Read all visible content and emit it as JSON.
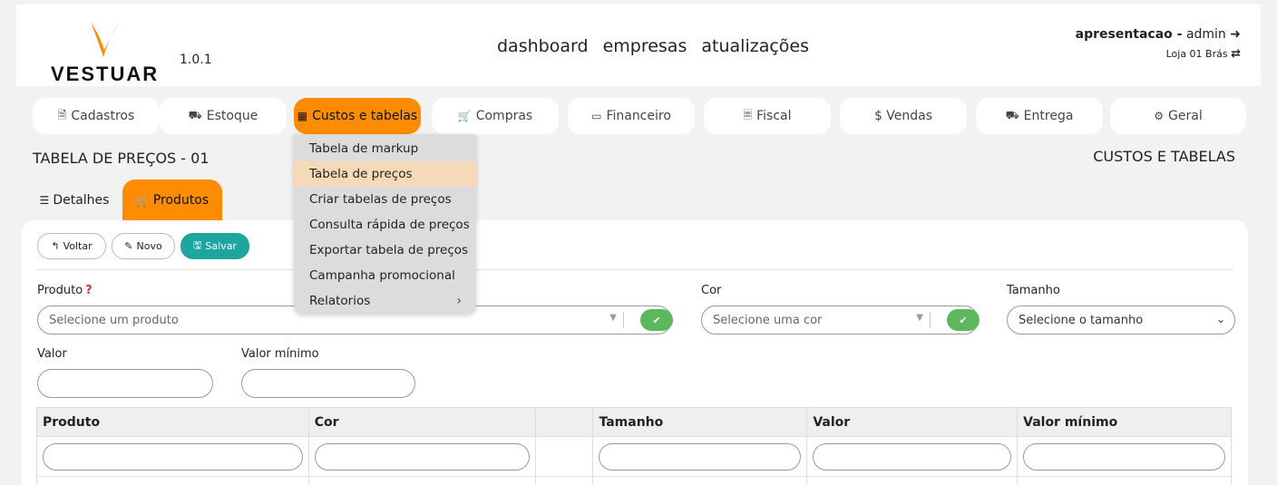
{
  "brand": {
    "name": "VESTUAR",
    "version": "1.0.1",
    "accent": "#ff8c00"
  },
  "topnav": {
    "items": [
      "dashboard",
      "empresas",
      "atualizações"
    ]
  },
  "user": {
    "company": "apresentacao -",
    "role": "admin",
    "store": "Loja 01 Brás"
  },
  "tabs": [
    {
      "label": "Cadastros",
      "icon": "file-icon"
    },
    {
      "label": "Estoque",
      "icon": "truck-icon"
    },
    {
      "label": "Custos e tabelas",
      "icon": "table-icon"
    },
    {
      "label": "Compras",
      "icon": "cart-icon"
    },
    {
      "label": "Financeiro",
      "icon": "credit-card-icon"
    },
    {
      "label": "Fiscal",
      "icon": "document-icon"
    },
    {
      "label": "$ Vendas",
      "icon": "dollar-icon"
    },
    {
      "label": "Entrega",
      "icon": "truck-icon"
    },
    {
      "label": "Geral",
      "icon": "gears-icon"
    }
  ],
  "page": {
    "title": "TABELA DE PREÇOS - 01",
    "section": "CUSTOS E TABELAS"
  },
  "subtabs": {
    "details": "Detalhes",
    "products": "Produtos"
  },
  "toolbar": {
    "back": "Voltar",
    "new": "Novo",
    "save": "Salvar"
  },
  "form": {
    "product_label": "Produto",
    "required_mark": "?",
    "product_placeholder": "Selecione um produto",
    "color_label": "Cor",
    "color_placeholder": "Selecione uma cor",
    "size_label": "Tamanho",
    "size_placeholder": "Selecione o tamanho",
    "value_label": "Valor",
    "min_value_label": "Valor mínimo"
  },
  "table": {
    "headers": [
      "Produto",
      "Cor",
      "",
      "Tamanho",
      "Valor",
      "Valor mínimo"
    ]
  },
  "dropdown": {
    "items": [
      "Tabela de markup",
      "Tabela de preços",
      "Criar tabelas de preços",
      "Consulta rápida de preços",
      "Exportar tabela de preços",
      "Campanha promocional",
      "Relatorios"
    ],
    "highlighted": "Tabela de preços"
  }
}
